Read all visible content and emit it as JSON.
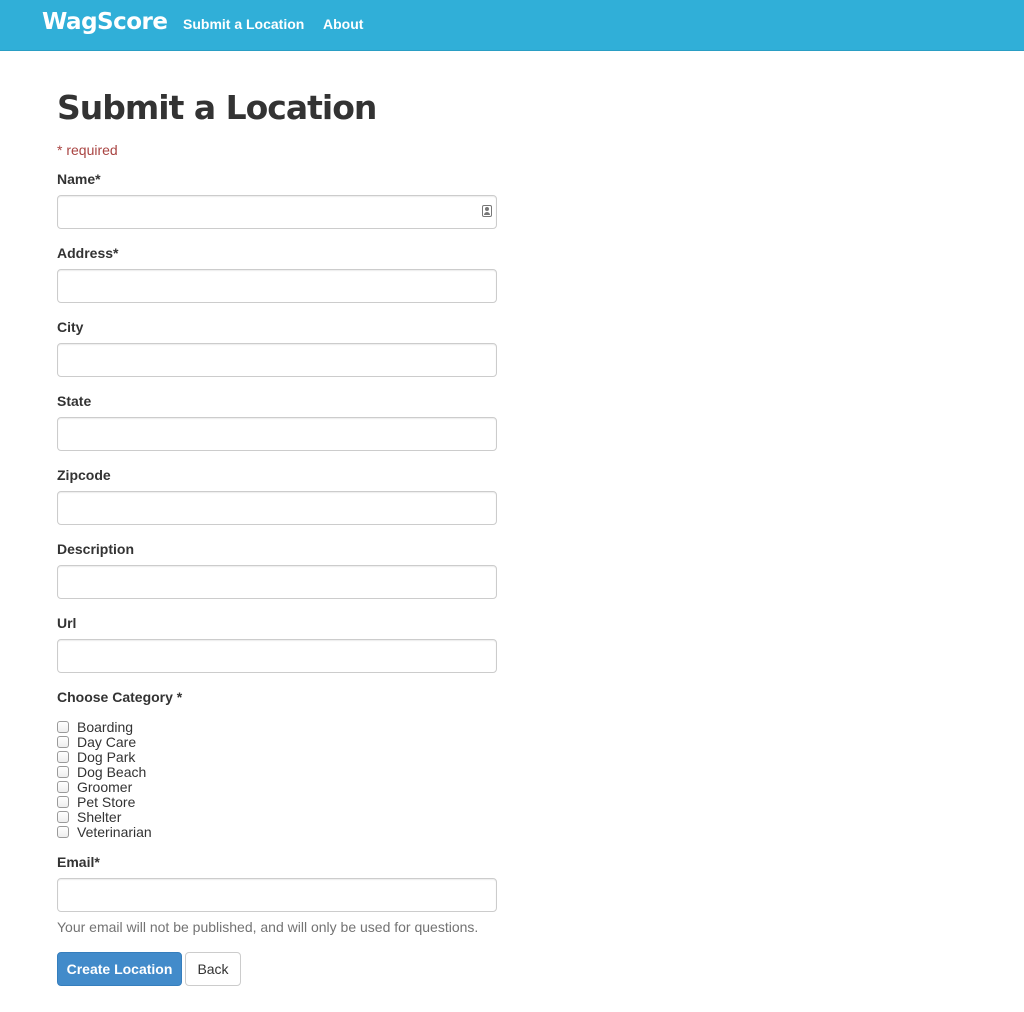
{
  "nav": {
    "brand": "WagScore",
    "links": [
      "Submit a Location",
      "About"
    ]
  },
  "form": {
    "title": "Submit a Location",
    "required_note": "* required",
    "fields": {
      "name": {
        "label": "Name*",
        "value": ""
      },
      "address": {
        "label": "Address*",
        "value": ""
      },
      "city": {
        "label": "City",
        "value": ""
      },
      "state": {
        "label": "State",
        "value": ""
      },
      "zipcode": {
        "label": "Zipcode",
        "value": ""
      },
      "description": {
        "label": "Description",
        "value": ""
      },
      "url": {
        "label": "Url",
        "value": ""
      },
      "email": {
        "label": "Email*",
        "value": ""
      }
    },
    "category_label": "Choose Category *",
    "categories": [
      "Boarding",
      "Day Care",
      "Dog Park",
      "Dog Beach",
      "Groomer",
      "Pet Store",
      "Shelter",
      "Veterinarian"
    ],
    "email_help": "Your email will not be published, and will only be used for questions.",
    "buttons": {
      "create": "Create Location",
      "back": "Back"
    }
  },
  "icons": {
    "name_field": "contact-card-icon"
  },
  "colors": {
    "navbar": "#30afd8",
    "primary": "#428bca",
    "required": "#a94442"
  }
}
